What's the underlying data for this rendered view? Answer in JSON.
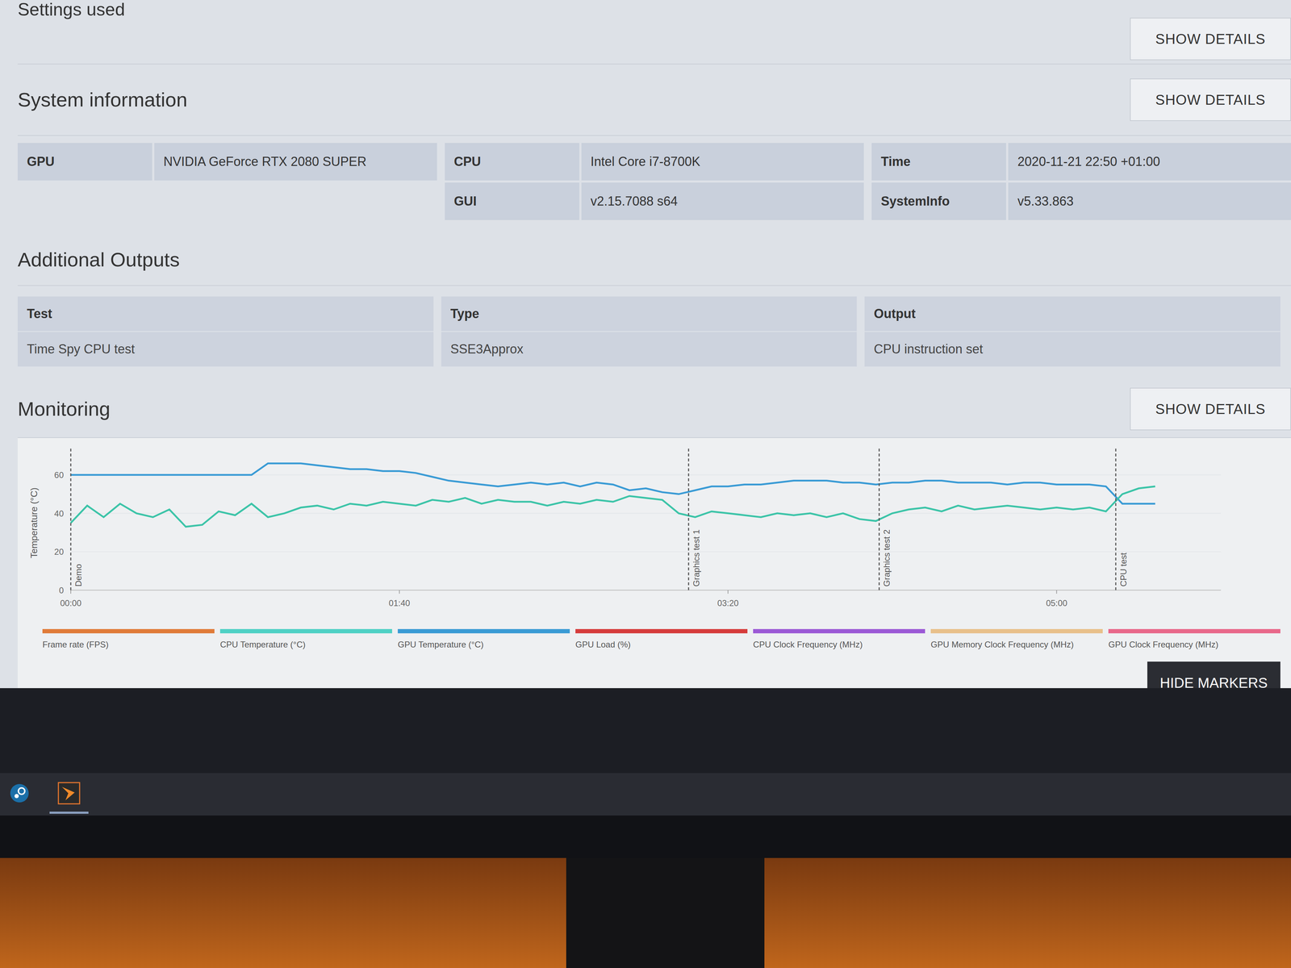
{
  "settings": {
    "title": "Settings used",
    "button": "SHOW DETAILS"
  },
  "system_information": {
    "title": "System information",
    "button": "SHOW DETAILS",
    "columns": [
      [
        {
          "key": "GPU",
          "value": "NVIDIA GeForce RTX 2080 SUPER"
        }
      ],
      [
        {
          "key": "CPU",
          "value": "Intel Core i7-8700K"
        },
        {
          "key": "GUI",
          "value": "v2.15.7088 s64"
        }
      ],
      [
        {
          "key": "Time",
          "value": "2020-11-21 22:50 +01:00"
        },
        {
          "key": "SystemInfo",
          "value": "v5.33.863"
        }
      ]
    ]
  },
  "additional_outputs": {
    "title": "Additional Outputs",
    "columns": [
      "Test",
      "Type",
      "Output"
    ],
    "rows": [
      [
        "Time Spy CPU test",
        "SSE3Approx",
        "CPU instruction set"
      ]
    ]
  },
  "monitoring": {
    "title": "Monitoring",
    "button": "SHOW DETAILS",
    "hide_markers": "HIDE MARKERS",
    "chart": {
      "y_label": "Temperature (°C)",
      "y_max": 70,
      "x_max": 350,
      "sample_seconds": 5,
      "y_ticks": [
        {
          "value": 0,
          "label": "0"
        },
        {
          "value": 20,
          "label": "20"
        },
        {
          "value": 40,
          "label": "40"
        },
        {
          "value": 60,
          "label": "60"
        }
      ],
      "x_ticks": [
        {
          "value": 0,
          "label": "00:00"
        },
        {
          "value": 100,
          "label": "01:40"
        },
        {
          "value": 200,
          "label": "03:20"
        },
        {
          "value": 300,
          "label": "05:00"
        }
      ],
      "markers": [
        {
          "label": "Demo",
          "time": 0
        },
        {
          "label": "Graphics test 1",
          "time": 188
        },
        {
          "label": "Graphics test 2",
          "time": 246
        },
        {
          "label": "CPU test",
          "time": 318
        }
      ],
      "series": [
        {
          "color": "#3a9bd5",
          "values": [
            60,
            60,
            60,
            60,
            60,
            60,
            60,
            60,
            60,
            60,
            60,
            60,
            66,
            66,
            66,
            65,
            64,
            63,
            63,
            62,
            62,
            61,
            59,
            57,
            56,
            55,
            54,
            55,
            56,
            55,
            56,
            54,
            56,
            55,
            52,
            53,
            51,
            50,
            52,
            54,
            54,
            55,
            55,
            56,
            57,
            57,
            57,
            56,
            56,
            55,
            56,
            56,
            57,
            57,
            56,
            56,
            56,
            55,
            56,
            56,
            55,
            55,
            55,
            54,
            45,
            45,
            45
          ]
        },
        {
          "color": "#3cc4a8",
          "values": [
            35,
            44,
            38,
            45,
            40,
            38,
            42,
            33,
            34,
            41,
            39,
            45,
            38,
            40,
            43,
            44,
            42,
            45,
            44,
            46,
            45,
            44,
            47,
            46,
            48,
            45,
            47,
            46,
            46,
            44,
            46,
            45,
            47,
            46,
            49,
            48,
            47,
            40,
            38,
            41,
            40,
            39,
            38,
            40,
            39,
            40,
            38,
            40,
            37,
            36,
            40,
            42,
            43,
            41,
            44,
            42,
            43,
            44,
            43,
            42,
            43,
            42,
            43,
            41,
            50,
            53,
            54
          ]
        }
      ],
      "legend": [
        {
          "label": "Frame rate (FPS)",
          "color": "#e07b39"
        },
        {
          "label": "CPU Temperature (°C)",
          "color": "#4fd1c5"
        },
        {
          "label": "GPU Temperature (°C)",
          "color": "#3a9bd5"
        },
        {
          "label": "GPU Load (%)",
          "color": "#d63c3c"
        },
        {
          "label": "CPU Clock Frequency (MHz)",
          "color": "#9b59d6"
        },
        {
          "label": "GPU Memory Clock Frequency (MHz)",
          "color": "#e8c08a"
        },
        {
          "label": "GPU Clock Frequency (MHz)",
          "color": "#e8688a"
        }
      ]
    }
  },
  "taskbar": {
    "apps": [
      {
        "kind": "steam",
        "active": false
      },
      {
        "kind": "benchmark",
        "active": true
      }
    ]
  }
}
